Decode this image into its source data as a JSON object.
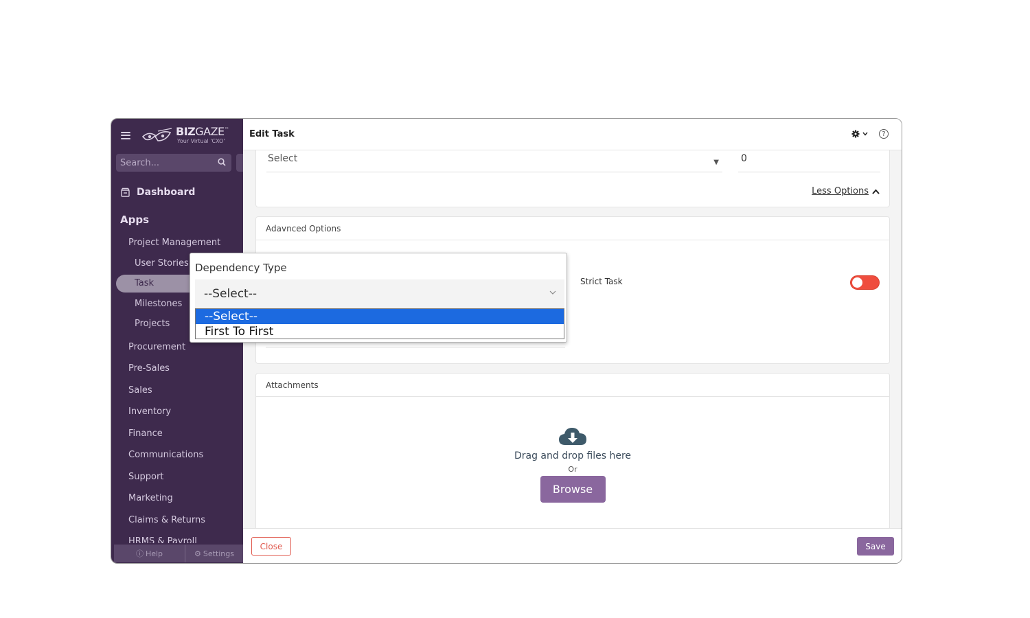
{
  "sidebar": {
    "logo_title_bold": "BIZ",
    "logo_title_light": "GAZE",
    "logo_tm": "™",
    "logo_subtitle": "Your Virtual 'CXO'",
    "search_placeholder": "Search...",
    "dashboard_label": "Dashboard",
    "apps_label": "Apps",
    "modules": [
      {
        "label": "Project Management"
      },
      {
        "label": "Procurement"
      },
      {
        "label": "Pre-Sales"
      },
      {
        "label": "Sales"
      },
      {
        "label": "Inventory"
      },
      {
        "label": "Finance"
      },
      {
        "label": "Communications"
      },
      {
        "label": "Support"
      },
      {
        "label": "Marketing"
      },
      {
        "label": "Claims & Returns"
      },
      {
        "label": "HRMS & Payroll"
      }
    ],
    "project_items": [
      {
        "label": "User Stories"
      },
      {
        "label": "Task"
      },
      {
        "label": "Milestones"
      },
      {
        "label": "Projects"
      }
    ],
    "footer_help": "Help",
    "footer_settings": "Settings"
  },
  "topbar": {
    "title": "Edit Task",
    "help_icon": "?"
  },
  "card1": {
    "select_value": "Select",
    "number_value": "0",
    "less_options": "Less Options"
  },
  "advanced": {
    "header": "Adavnced Options",
    "strict_task_label": "Strict Task",
    "strict_task_on": true
  },
  "attachments": {
    "header": "Attachments",
    "drag_text": "Drag and drop files here",
    "or_text": "Or",
    "browse_label": "Browse"
  },
  "footer": {
    "close_label": "Close",
    "save_label": "Save"
  },
  "dependency_popup": {
    "label": "Dependency Type",
    "selected_value": "--Select--",
    "options": [
      {
        "label": "--Select--",
        "selected": true
      },
      {
        "label": "First To First",
        "selected": false
      }
    ]
  },
  "colors": {
    "sidebar_bg": "#3e2a4d",
    "accent_purple": "#8a679e",
    "toggle_red": "#ef4d3e",
    "option_selected_blue": "#1c6ae0",
    "close_red": "#e05a4f"
  }
}
